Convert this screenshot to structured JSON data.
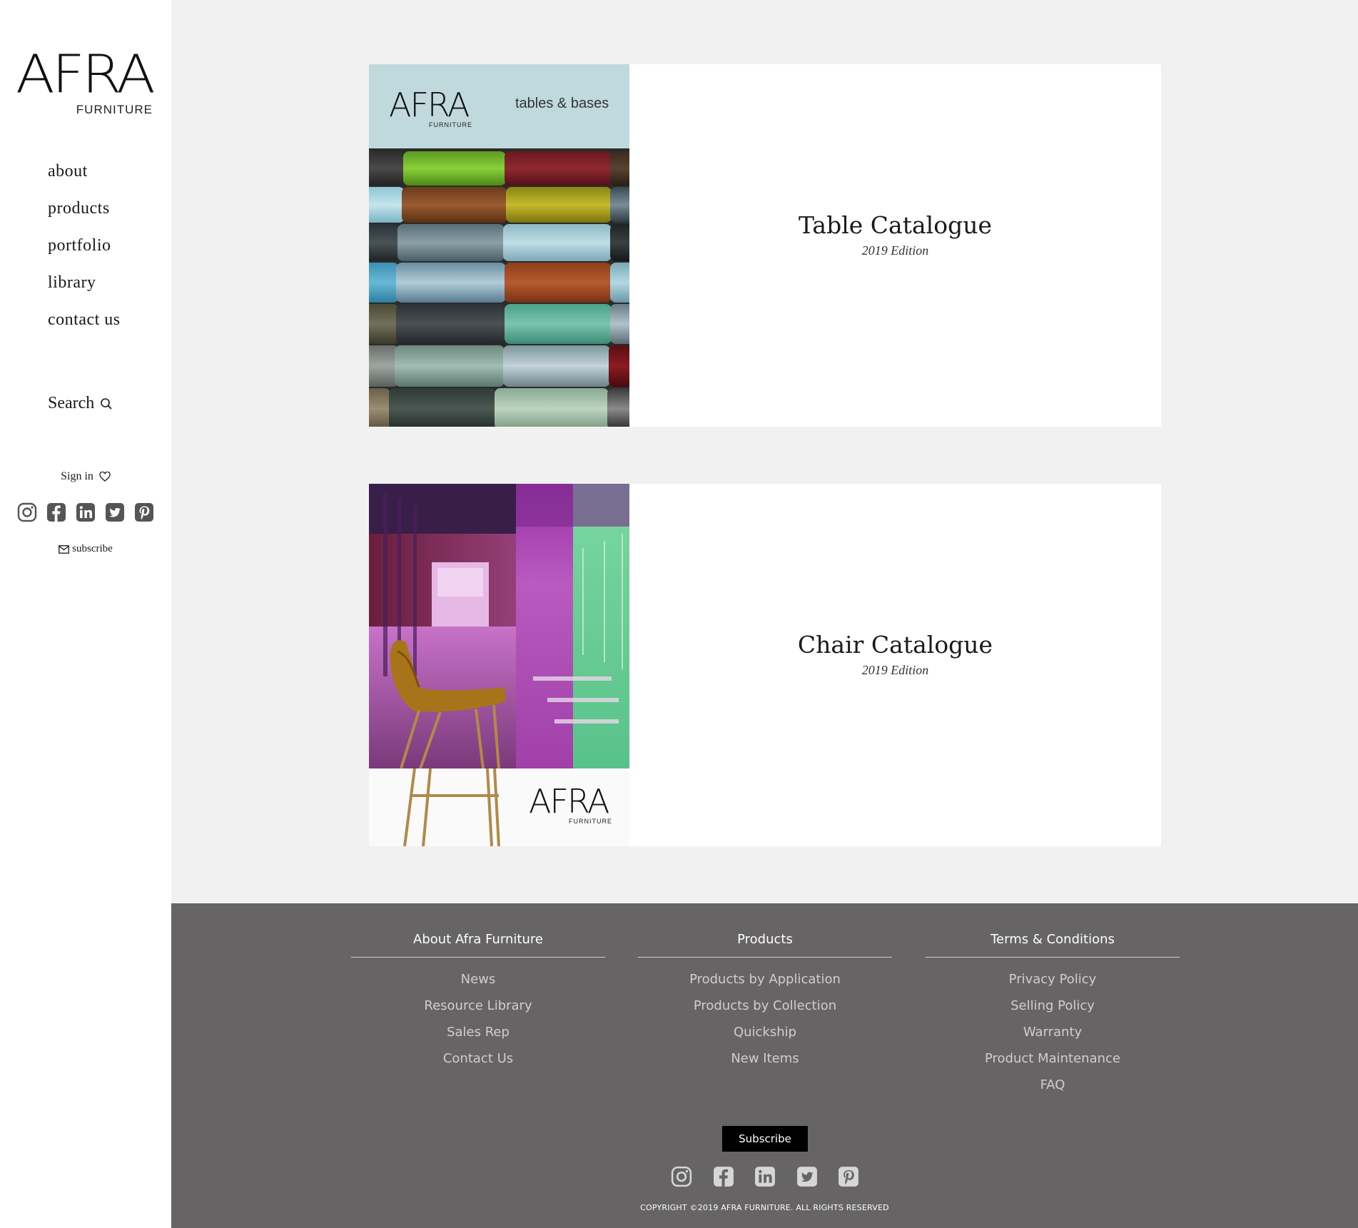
{
  "sidebar": {
    "logo": {
      "main": "AFRA",
      "sub": "FURNITURE"
    },
    "nav": [
      {
        "label": "about"
      },
      {
        "label": "products"
      },
      {
        "label": "portfolio"
      },
      {
        "label": "library"
      },
      {
        "label": "contact us"
      }
    ],
    "search_label": "Search",
    "signin_label": "Sign in",
    "social_icons": [
      "instagram-icon",
      "facebook-icon",
      "linkedin-icon",
      "twitter-icon",
      "pinterest-icon"
    ],
    "subscribe_label": "subscribe"
  },
  "catalogues": [
    {
      "title": "Table Catalogue",
      "edition": "2019 Edition",
      "cover": {
        "brand": "AFRA",
        "brand_sub": "FURNITURE",
        "tagline": "tables & bases"
      }
    },
    {
      "title": "Chair Catalogue",
      "edition": "2019 Edition",
      "cover": {
        "brand": "AFRA",
        "brand_sub": "FURNITURE"
      }
    }
  ],
  "footer": {
    "columns": [
      {
        "heading": "About Afra Furniture",
        "links": [
          "News",
          "Resource Library",
          "Sales Rep",
          "Contact Us"
        ]
      },
      {
        "heading": "Products",
        "links": [
          "Products by Application",
          "Products by Collection",
          "Quickship",
          "New Items"
        ]
      },
      {
        "heading": "Terms & Conditions",
        "links": [
          "Privacy Policy",
          "Selling Policy",
          "Warranty",
          "Product Maintenance",
          "FAQ"
        ]
      }
    ],
    "subscribe_label": "Subscribe",
    "copyright": "COPYRIGHT ©2019 AFRA FURNITURE. ALL RIGHTS RESERVED"
  },
  "colors": {
    "page_bg": "#f1f1f1",
    "footer_bg": "#666465",
    "table_cover_header": "#bfd9dc"
  }
}
